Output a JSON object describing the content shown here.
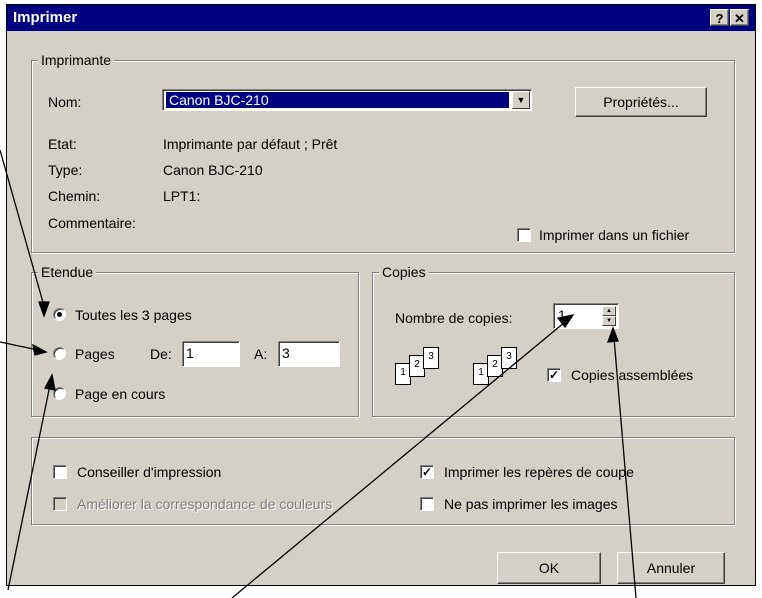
{
  "window": {
    "title": "Imprimer",
    "help_label": "?",
    "close_label": "✕"
  },
  "printer": {
    "legend": "Imprimante",
    "name_label": "Nom:",
    "name_value": "Canon  BJC-210",
    "properties_button": "Propriétés...",
    "state_label": "Etat:",
    "state_value": "Imprimante par défaut ; Prêt",
    "type_label": "Type:",
    "type_value": "Canon  BJC-210",
    "path_label": "Chemin:",
    "path_value": "LPT1:",
    "comment_label": "Commentaire:",
    "print_to_file_label": "Imprimer dans un fichier",
    "print_to_file_checked": false
  },
  "range": {
    "legend": "Etendue",
    "all_pages_label": "Toutes les 3 pages",
    "all_pages_selected": true,
    "pages_label": "Pages",
    "from_label": "De:",
    "from_value": "1",
    "to_label": "A:",
    "to_value": "3",
    "current_page_label": "Page en cours"
  },
  "copies": {
    "legend": "Copies",
    "count_label": "Nombre de copies:",
    "count_value": "1",
    "collate_label": "Copies assemblées",
    "collate_checked": true,
    "page_numbers": [
      "1",
      "2",
      "3"
    ]
  },
  "options": {
    "advise_label": "Conseiller d'impression",
    "advise_checked": false,
    "improve_color_label": "Améliorer la correspondance de couleurs",
    "improve_color_enabled": false,
    "crop_marks_label": "Imprimer les repères de coupe",
    "crop_marks_checked": true,
    "no_images_label": "Ne pas imprimer les images",
    "no_images_checked": false
  },
  "buttons": {
    "ok": "OK",
    "cancel": "Annuler"
  },
  "colors": {
    "titlebar": "#000080",
    "face": "#d4d0c8",
    "selection": "#000080"
  }
}
